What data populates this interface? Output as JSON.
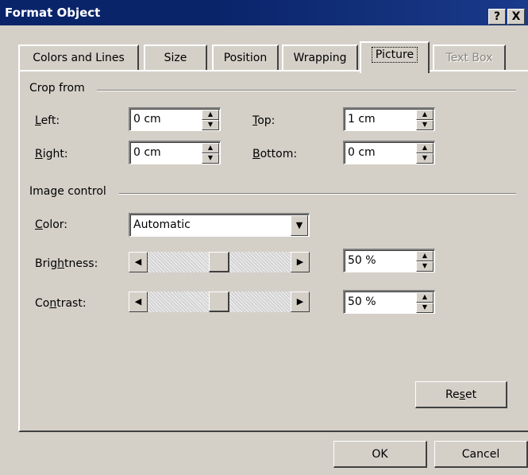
{
  "window": {
    "title": "Format Object",
    "help_glyph": "?",
    "close_glyph": "X"
  },
  "tabs": [
    {
      "label": "Colors and Lines",
      "active": false,
      "disabled": false
    },
    {
      "label": "Size",
      "active": false,
      "disabled": false
    },
    {
      "label": "Position",
      "active": false,
      "disabled": false
    },
    {
      "label": "Wrapping",
      "active": false,
      "disabled": false
    },
    {
      "label": "Picture",
      "active": true,
      "disabled": false
    },
    {
      "label": "Text Box",
      "active": false,
      "disabled": true
    }
  ],
  "crop": {
    "heading": "Crop from",
    "left": {
      "label": "Left:",
      "accel": "L",
      "rest": "eft:",
      "value": "0 cm"
    },
    "right": {
      "label": "Right:",
      "accel": "R",
      "rest": "ight:",
      "value": "0 cm"
    },
    "top": {
      "label": "Top:",
      "accel": "T",
      "rest": "op:",
      "value": "1 cm"
    },
    "bottom": {
      "label": "Bottom:",
      "accel": "B",
      "rest": "ottom:",
      "value": "0 cm"
    }
  },
  "image_control": {
    "heading": "Image control",
    "color": {
      "label": "Color:",
      "accel": "C",
      "rest": "olor:",
      "value": "Automatic"
    },
    "brightness": {
      "label_pre": "Brig",
      "accel": "h",
      "label_post": "tness:",
      "value": "50 %",
      "level": 0.5
    },
    "contrast": {
      "label_pre": "Co",
      "accel": "n",
      "label_post": "trast:",
      "value": "50 %",
      "level": 0.5
    },
    "reset": {
      "pre": "Re",
      "accel": "s",
      "post": "et"
    }
  },
  "buttons": {
    "ok": "OK",
    "cancel": "Cancel"
  },
  "icons": {
    "spin_up": "▲",
    "spin_down": "▼",
    "dropdown": "▼",
    "scroll_left": "◀",
    "scroll_right": "▶"
  }
}
